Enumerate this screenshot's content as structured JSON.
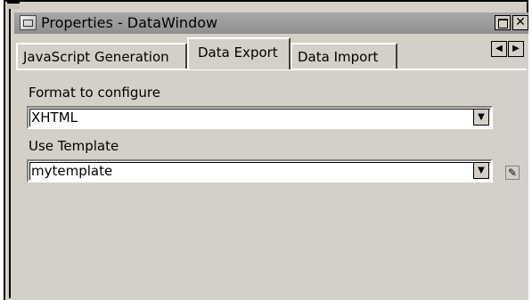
{
  "window": {
    "title": "Properties - DataWindow"
  },
  "tabs": [
    {
      "label": "JavaScript Generation",
      "active": false
    },
    {
      "label": "Data Export",
      "active": true
    },
    {
      "label": "Data Import",
      "active": false
    }
  ],
  "form": {
    "format_label": "Format to configure",
    "format_value": "XHTML",
    "template_label": "Use Template",
    "template_value": "mytemplate"
  },
  "icons": {
    "title": "properties-window-icon",
    "maximize": "maximize-icon",
    "close": "close-icon",
    "scroll_left": "arrow-left-icon",
    "scroll_right": "arrow-right-icon",
    "dropdown": "chevron-down-icon",
    "edit_template": "edit-icon"
  },
  "colors": {
    "face": "#d4d0c8",
    "titlebar": "#9b9b9b"
  }
}
